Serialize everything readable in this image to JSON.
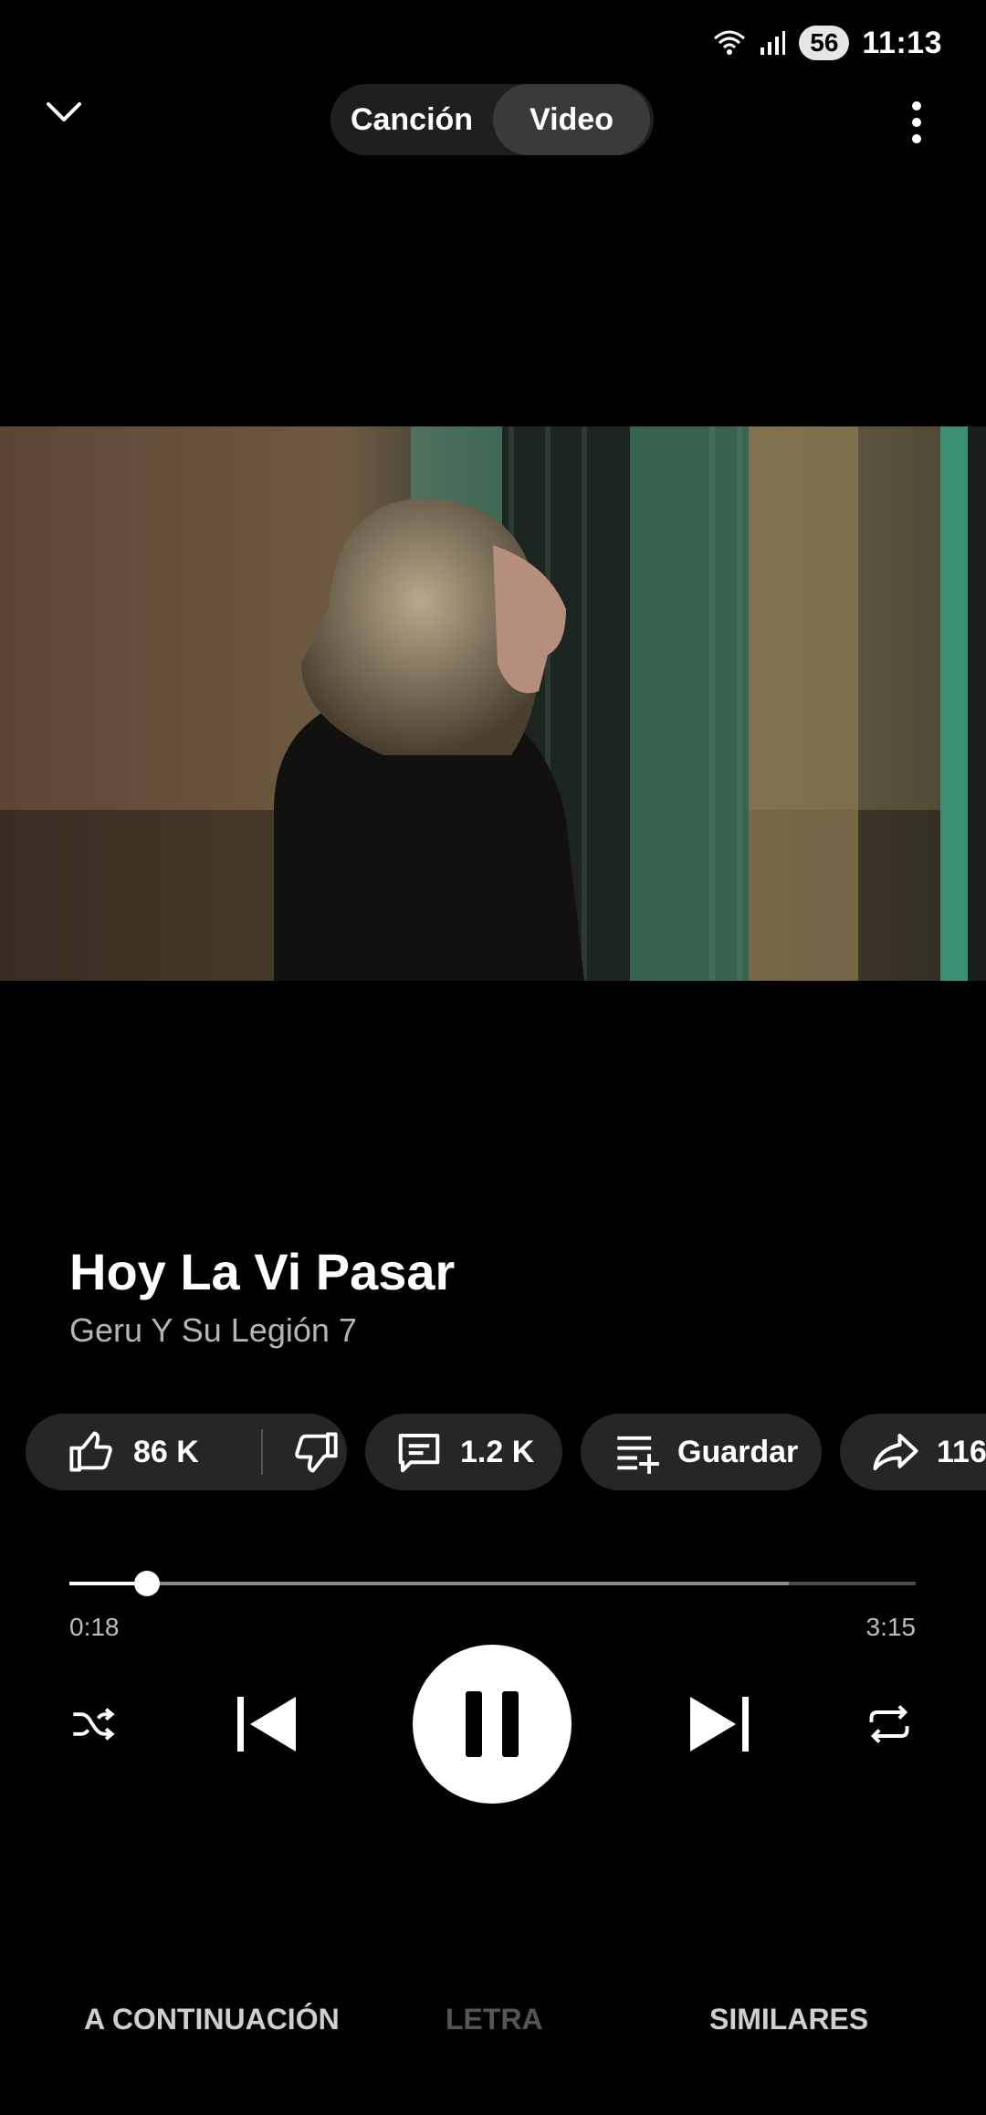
{
  "status_bar": {
    "time": "11:13",
    "battery": "56",
    "icons": [
      "wifi-icon",
      "signal-icon"
    ]
  },
  "top_bar": {
    "collapse_icon": "chevron-down-icon",
    "toggle": {
      "options": [
        "Canción",
        "Video"
      ],
      "selected": "Video"
    },
    "menu_icon": "more-vert-icon"
  },
  "track": {
    "title": "Hoy La Vi Pasar",
    "artist": "Geru Y Su Legión 7"
  },
  "actions": {
    "likes": "86 K",
    "comments": "1.2 K",
    "save": "Guardar",
    "shares": "116"
  },
  "progress": {
    "current": "0:18",
    "total": "3:15",
    "played_fraction": 0.092,
    "buffered_fraction": 0.85
  },
  "controls": [
    "shuffle-icon",
    "previous-icon",
    "pause-icon",
    "next-icon",
    "repeat-icon"
  ],
  "tabs": [
    {
      "label": "A CONTINUACIÓN",
      "active": false
    },
    {
      "label": "LETRA",
      "active": false,
      "disabled": true
    },
    {
      "label": "SIMILARES",
      "active": false
    }
  ],
  "colors": {
    "background": "#000000",
    "chip": "#262626",
    "accent": "#ffffff",
    "muted_text": "#b5b5b5",
    "disabled_text": "#555555"
  }
}
